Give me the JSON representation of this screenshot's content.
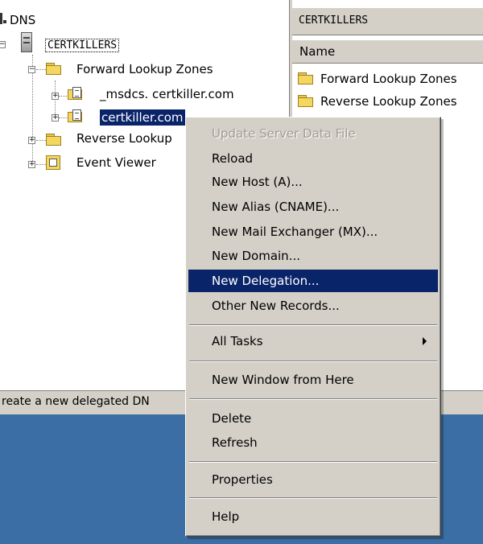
{
  "tree": {
    "root_label": "DNS",
    "server_label": "CERTKILLERS",
    "forward_zones_label": "Forward Lookup Zones",
    "msdcs_label": "_msdcs. certkiller.com",
    "certkiller_label": "certkiller.com",
    "reverse_zones_label": "Reverse Lookup",
    "event_viewer_label": "Event Viewer"
  },
  "right_pane": {
    "header_title": "CERTKILLERS",
    "column_name": "Name",
    "items": [
      "Forward Lookup Zones",
      "Reverse Lookup Zones"
    ]
  },
  "status_bar": {
    "text": "reate a new delegated DN"
  },
  "context_menu": {
    "items": [
      {
        "label": "Update Server Data File",
        "state": "disabled"
      },
      {
        "label": "Reload"
      },
      {
        "label": "New Host (A)..."
      },
      {
        "label": "New Alias (CNAME)..."
      },
      {
        "label": "New Mail Exchanger (MX)..."
      },
      {
        "label": "New Domain..."
      },
      {
        "label": "New Delegation...",
        "state": "highlighted"
      },
      {
        "label": "Other New Records..."
      },
      {
        "label": "All Tasks",
        "submenu": true
      },
      {
        "label": "New Window from Here"
      },
      {
        "label": "Delete"
      },
      {
        "label": "Refresh"
      },
      {
        "label": "Properties"
      },
      {
        "label": "Help"
      }
    ]
  },
  "colors": {
    "menu_bg": "#d4d0c8",
    "highlight_bg": "#0a246a",
    "desktop": "#3a6ea5",
    "selection": "#0a246a"
  }
}
